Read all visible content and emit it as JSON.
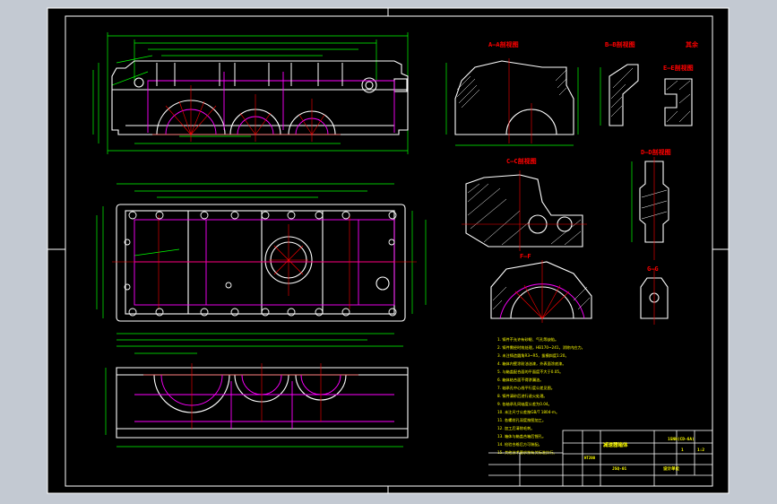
{
  "colors": {
    "viewport_bg": "#c3c9d2",
    "sheet_bg": "#000000",
    "frame": "#ffffff",
    "outline": "#ffffff",
    "dim": "#00ff00",
    "center": "#ff0000",
    "hidden": "#ff00ff",
    "note_text": "#ffff00",
    "hatch": "#ffffff"
  },
  "section_labels": {
    "a": "A—A剖视图",
    "b": "B—B剖视图",
    "c": "C—C剖视图",
    "d": "D—D剖视图",
    "e": "E—E剖视图",
    "f": "F—F",
    "g": "G—G",
    "other": "其余"
  },
  "notes": [
    "1. 铸件不允许有砂眼、气孔等缺陷。",
    "2. 铸件需经时效处理，HB170~241，消除内应力。",
    "3. 未注铸造圆角R3~R5，拔模斜度1:20。",
    "4. 箱体内壁涂耐油油漆，外表面涂底漆。",
    "5. 与箱盖配合面的平面度不大于0.05。",
    "6. 箱体结合面不得渗漏油。",
    "7. 轴承孔中心线平行度公差见图。",
    "8. 铸件清砂后进行退火处理。",
    "9. 各轴承孔同轴度公差为0.04。",
    "10. 未注尺寸公差按GB/T 1804-m。",
    "11. 各螺纹孔深度按图加工。",
    "12. 加工后清除毛刺。",
    "13. 箱体与箱盖合箱后镗孔。",
    "14. 检验合格后方可装配。",
    "15. 其他技术要求按有关标准执行。"
  ],
  "title_block": {
    "part_title": "减速器箱体",
    "material": "HT200",
    "scale": "1:2",
    "drawing_no": "JSQ-01",
    "mark": "15NH(CD-6A)",
    "row1": "1",
    "row2": "1:2",
    "school": "设计单位"
  }
}
